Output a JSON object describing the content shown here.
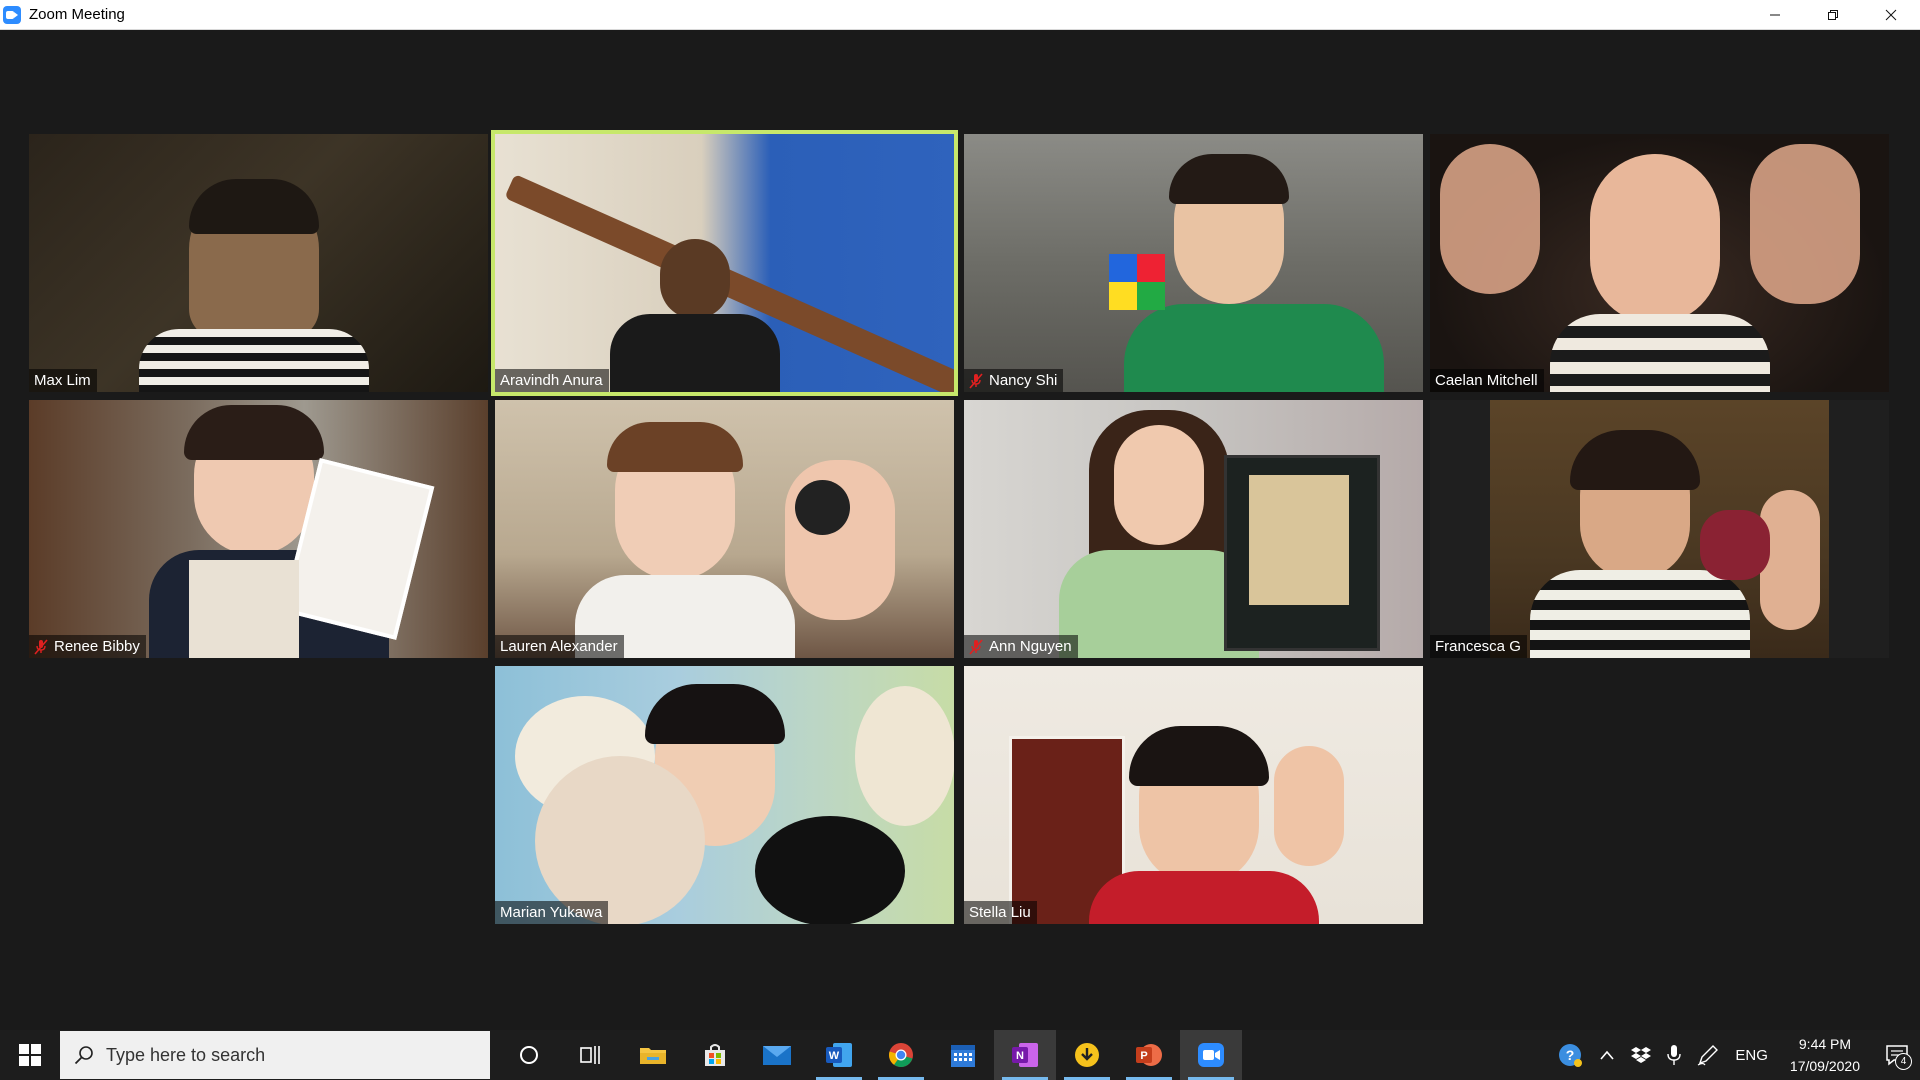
{
  "window": {
    "title": "Zoom Meeting"
  },
  "participants": [
    {
      "name": "Max Lim",
      "muted": false,
      "active": false
    },
    {
      "name": "Aravindh Anura",
      "muted": false,
      "active": true
    },
    {
      "name": "Nancy Shi",
      "muted": true,
      "active": false
    },
    {
      "name": "Caelan Mitchell",
      "muted": false,
      "active": false
    },
    {
      "name": "Renee Bibby",
      "muted": true,
      "active": false
    },
    {
      "name": "Lauren Alexander",
      "muted": false,
      "active": false
    },
    {
      "name": "Ann Nguyen",
      "muted": true,
      "active": false
    },
    {
      "name": "Francesca G",
      "muted": false,
      "active": false
    },
    {
      "name": "Marian Yukawa",
      "muted": false,
      "active": false
    },
    {
      "name": "Stella Liu",
      "muted": false,
      "active": false
    }
  ],
  "taskbar": {
    "search_placeholder": "Type here to search",
    "apps": [
      "cortana-icon",
      "task-view-icon",
      "file-explorer-icon",
      "store-icon",
      "mail-icon",
      "word-icon",
      "chrome-icon",
      "calendar-icon",
      "onenote-icon",
      "downloader-icon",
      "powerpoint-icon",
      "zoom-icon"
    ],
    "language": "ENG",
    "time": "9:44 PM",
    "date": "17/09/2020",
    "notifications": "4"
  },
  "colors": {
    "active_speaker": "#c7e86b",
    "zoom_blue": "#2d8cff",
    "mute_red": "#e02020"
  }
}
